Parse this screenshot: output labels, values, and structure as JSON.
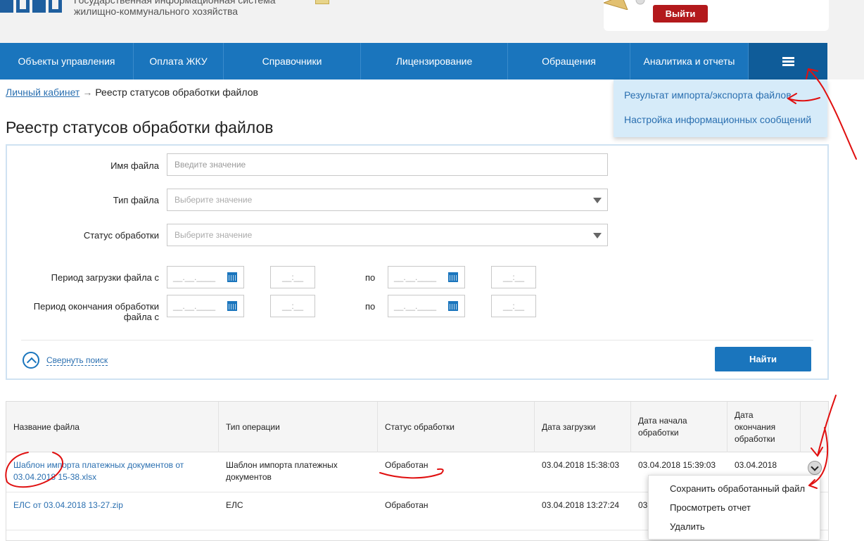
{
  "header": {
    "org_title_line1": "Государственная информационная система",
    "org_title_line2": "жилищно-коммунального хозяйства",
    "logout_label": "Выйти"
  },
  "nav": {
    "items": [
      {
        "label": "Объекты управления"
      },
      {
        "label": "Оплата ЖКУ"
      },
      {
        "label": "Справочники"
      },
      {
        "label": "Лицензирование"
      },
      {
        "label": "Обращения"
      },
      {
        "label": "Аналитика и отчеты"
      }
    ],
    "menu_icon": "hamburger-menu-icon"
  },
  "dropdown": {
    "items": [
      {
        "label": "Результат импорта/экспорта файлов"
      },
      {
        "label": "Настройка информационных сообщений"
      }
    ]
  },
  "breadcrumb": {
    "home_label": "Личный кабинет",
    "separator": "→",
    "current_label": "Реестр статусов обработки файлов"
  },
  "page": {
    "title": "Реестр статусов обработки файлов"
  },
  "search": {
    "file_name_label": "Имя файла",
    "file_name_placeholder": "Введите значение",
    "file_type_label": "Тип файла",
    "file_type_placeholder": "Выберите значение",
    "status_label": "Статус обработки",
    "status_placeholder": "Выберите значение",
    "upload_period_label": "Период загрузки файла с",
    "end_period_label_line1": "Период окончания обработки",
    "end_period_label_line2": "файла с",
    "to_label": "по",
    "date_mask": "__.__.____",
    "time_mask": "__:__",
    "collapse_label": "Свернуть поиск",
    "find_label": "Найти"
  },
  "table": {
    "columns": {
      "file_name": "Название файла",
      "operation_type": "Тип операции",
      "status": "Статус обработки",
      "upload_date": "Дата загрузки",
      "start_date_line1": "Дата начала",
      "start_date_line2": "обработки",
      "end_date_line1": "Дата",
      "end_date_line2": "окончания",
      "end_date_line3": "обработки"
    },
    "rows": [
      {
        "file_name_line1": "Шаблон импорта платежных документов от",
        "file_name_line2": "03.04.2018 15-38.xlsx",
        "operation_line1": "Шаблон импорта платежных",
        "operation_line2": "документов",
        "status": "Обработан",
        "upload_date": "03.04.2018 15:38:03",
        "start_date": "03.04.2018 15:39:03",
        "end_date_line1": "03.04.2018"
      },
      {
        "file_name_line1": "ЕЛС от 03.04.2018 13-27.zip",
        "operation_line1": "ЕЛС",
        "status": "Обработан",
        "upload_date": "03.04.2018 13:27:24",
        "start_date_partial": "03"
      }
    ]
  },
  "context_menu": {
    "items": [
      {
        "label": "Сохранить обработанный файл"
      },
      {
        "label": "Просмотреть отчет"
      },
      {
        "label": "Удалить"
      }
    ]
  },
  "colors": {
    "nav_bg": "#1a75bd",
    "logout_bg": "#b3191c",
    "link": "#2a6fb0",
    "annotation": "#e01010"
  }
}
